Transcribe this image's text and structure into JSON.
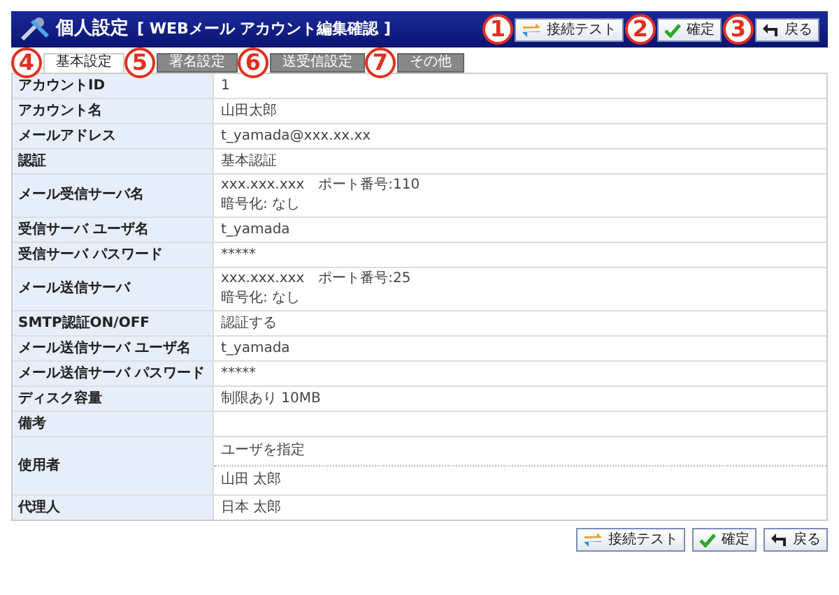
{
  "header": {
    "title": "個人設定",
    "subtitle": "[ WEBメール アカウント編集確認 ]",
    "buttons": [
      {
        "label": "接続テスト",
        "kind": "connect",
        "callout": "1"
      },
      {
        "label": "確定",
        "kind": "confirm",
        "callout": "2"
      },
      {
        "label": "戻る",
        "kind": "back",
        "callout": "3"
      }
    ]
  },
  "tabs": [
    {
      "label": "基本設定",
      "selected": true,
      "callout": "4"
    },
    {
      "label": "署名設定",
      "selected": false,
      "callout": "5"
    },
    {
      "label": "送受信設定",
      "selected": false,
      "callout": "6"
    },
    {
      "label": "その他",
      "selected": false,
      "callout": "7"
    }
  ],
  "rows": [
    {
      "label": "アカウントID",
      "kind": "plain",
      "values": [
        "1"
      ]
    },
    {
      "label": "アカウント名",
      "kind": "plain",
      "values": [
        "山田太郎"
      ]
    },
    {
      "label": "メールアドレス",
      "kind": "plain",
      "values": [
        "t_yamada@xxx.xx.xx"
      ]
    },
    {
      "label": "認証",
      "kind": "plain",
      "values": [
        "基本認証"
      ]
    },
    {
      "label": "メール受信サーバ名",
      "kind": "plain",
      "values": [
        "xxx.xxx.xxx　ポート番号:110",
        "暗号化: なし"
      ]
    },
    {
      "label": "受信サーバ ユーザ名",
      "kind": "plain",
      "values": [
        "t_yamada"
      ]
    },
    {
      "label": "受信サーバ パスワード",
      "kind": "plain",
      "values": [
        "*****"
      ]
    },
    {
      "label": "メール送信サーバ",
      "kind": "plain",
      "values": [
        "xxx.xxx.xxx　ポート番号:25",
        "暗号化: なし"
      ]
    },
    {
      "label": "SMTP認証ON/OFF",
      "kind": "plain",
      "values": [
        "認証する"
      ]
    },
    {
      "label": "メール送信サーバ ユーザ名",
      "kind": "plain",
      "values": [
        "t_yamada"
      ]
    },
    {
      "label": "メール送信サーバ パスワード",
      "kind": "plain",
      "values": [
        "*****"
      ]
    },
    {
      "label": "ディスク容量",
      "kind": "plain",
      "values": [
        "制限あり 10MB"
      ]
    },
    {
      "label": "備考",
      "kind": "plain"
    },
    {
      "label": "使用者",
      "kind": "split",
      "values": [
        "ユーザを指定",
        "山田 太郎"
      ]
    },
    {
      "label": "代理人",
      "kind": "plain",
      "values": [
        "日本 太郎"
      ]
    }
  ],
  "footer_buttons": [
    {
      "label": "接続テスト",
      "kind": "connect"
    },
    {
      "label": "確定",
      "kind": "confirm"
    },
    {
      "label": "戻る",
      "kind": "back"
    }
  ]
}
